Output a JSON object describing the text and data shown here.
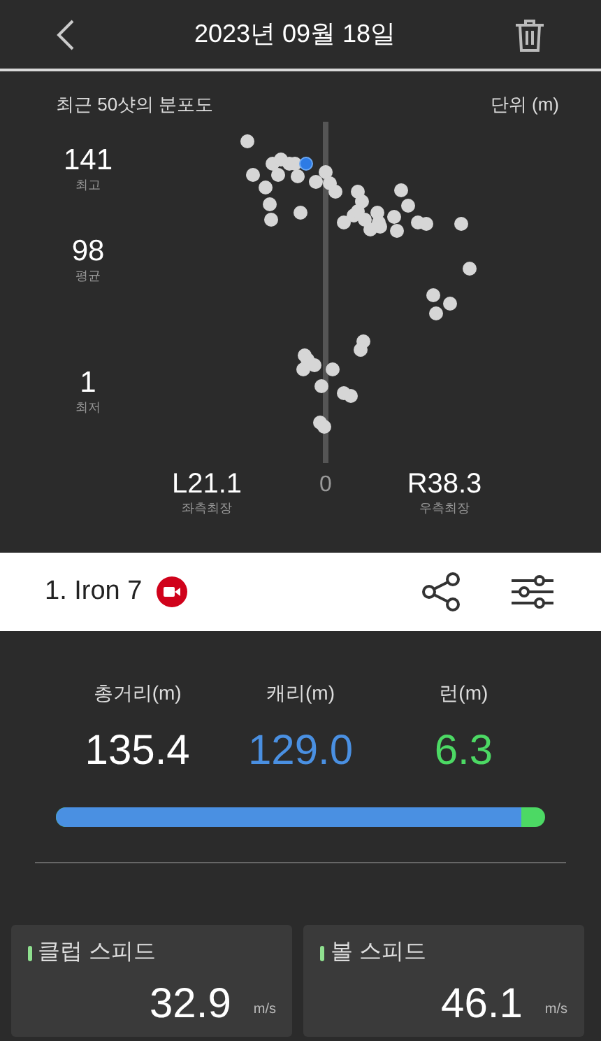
{
  "header": {
    "title": "2023년 09월 18일"
  },
  "dispersion": {
    "title": "최근 50샷의 분포도",
    "unit": "단위 (m)",
    "stats": [
      {
        "value": "141",
        "label": "최고"
      },
      {
        "value": "98",
        "label": "평균"
      },
      {
        "value": "1",
        "label": "최저"
      }
    ],
    "left": {
      "value": "L21.1",
      "label": "좌측최장"
    },
    "center": "0",
    "right": {
      "value": "R38.3",
      "label": "우측최장"
    }
  },
  "club": {
    "name": "1. Iron 7",
    "video": true
  },
  "distance": {
    "metrics": [
      {
        "label": "총거리(m)",
        "value": "135.4",
        "kind": "total"
      },
      {
        "label": "캐리(m)",
        "value": "129.0",
        "kind": "carry"
      },
      {
        "label": "런(m)",
        "value": "6.3",
        "kind": "run"
      }
    ],
    "level": 0.95
  },
  "speeds": [
    {
      "label": "클럽 스피드",
      "value": "32.9",
      "unit": "m/s"
    },
    {
      "label": "볼 스피드",
      "value": "46.1",
      "unit": "m/s"
    }
  ]
}
